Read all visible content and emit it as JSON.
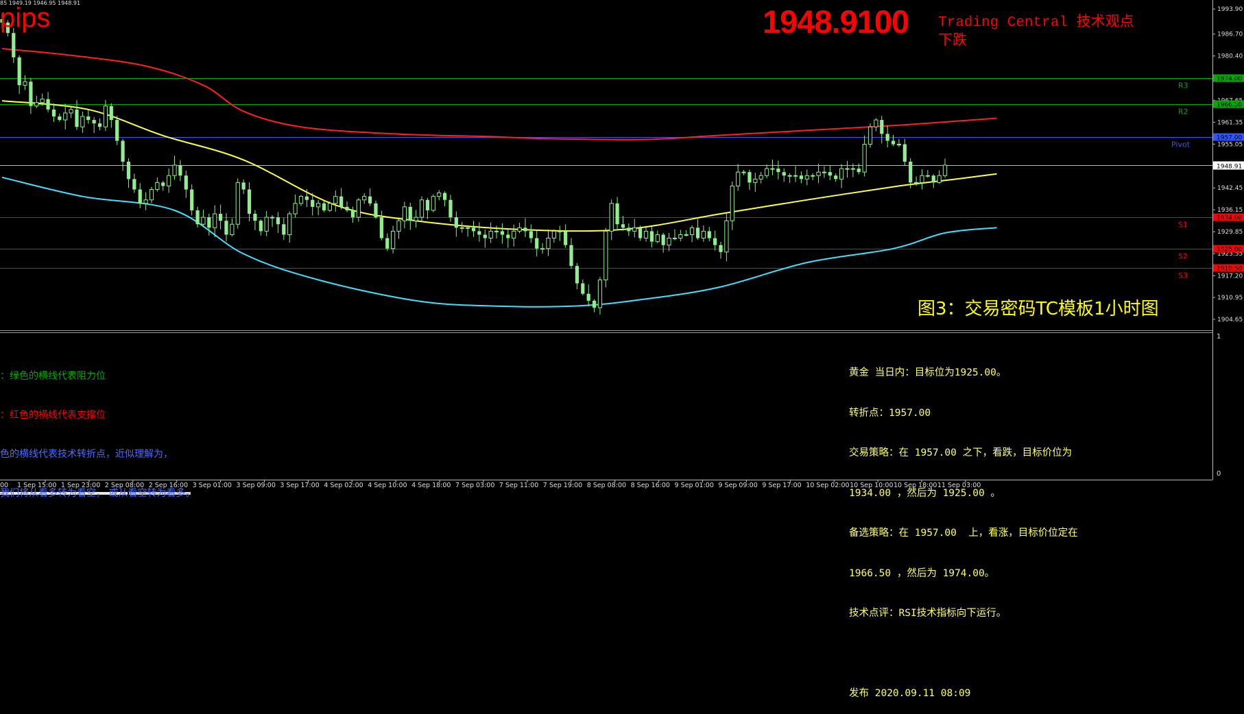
{
  "header": {
    "ohlc_text": "85 1949.19 1946.95 1948.91",
    "pips_label": "pips",
    "current_price": "1948.9100",
    "tc_title": "Trading Central 技术观点",
    "tc_view": "下跌"
  },
  "figure_label": "图3：交易密码TC模板1小时图",
  "legend": [
    {
      "text": "：绿色的横线代表阻力位",
      "color": "#00aa00"
    },
    {
      "text": "：红色的横线代表支撑位",
      "color": "#ff0000"
    },
    {
      "text": "色的横线代表技术转折点，近似理解为，",
      "color": "#4d6bff"
    },
    {
      "text": "我们将从看多转为看空， 或从看空转为看多。",
      "color": "#4d6bff"
    }
  ],
  "analysis": [
    "黄金 当日内：目标位为1925.00。",
    "转折点：1957.00",
    "交易策略：在 1957.00 之下，看跌，目标价位为",
    "1934.00 ，然后为 1925.00 。",
    "备选策略：在 1957.00  上，看涨，目标价位定在",
    "1966.50 ，然后为 1974.00。",
    "技术点评：RSI技术指标向下运行。",
    "",
    "发布 2020.09.11 08:09"
  ],
  "colors": {
    "background": "#000000",
    "resistance": "#00aa00",
    "support": "#ff0000",
    "pivot": "#3355ff",
    "upper_band": "#ff2020",
    "middle_ma": "#ffff40",
    "lower_band": "#40e0ff",
    "candle": "#90ee90",
    "price_line": "#bbbbbb"
  },
  "chart_data": {
    "type": "candlestick",
    "title": "",
    "symbol_timeframe": "1 hour",
    "ylim": [
      1901.5,
      1996.5
    ],
    "y_ticks": [
      "1993.90",
      "1986.70",
      "1980.40",
      "1974.00",
      "1967.65",
      "1966.50",
      "1961.35",
      "1957.00",
      "1955.05",
      "1948.91",
      "1942.45",
      "1936.15",
      "1934.00",
      "1929.85",
      "1925.00",
      "1923.55",
      "1919.50",
      "1917.20",
      "1910.95",
      "1904.65"
    ],
    "x_ticks": [
      "1 Sep 15:00",
      "1 Sep 23:00",
      "2 Sep 08:00",
      "2 Sep 16:00",
      "3 Sep 01:00",
      "3 Sep 09:00",
      "3 Sep 17:00",
      "4 Sep 02:00",
      "4 Sep 10:00",
      "4 Sep 18:00",
      "7 Sep 03:00",
      "7 Sep 11:00",
      "7 Sep 19:00",
      "8 Sep 08:00",
      "8 Sep 16:00",
      "9 Sep 01:00",
      "9 Sep 09:00",
      "9 Sep 17:00",
      "10 Sep 02:00",
      "10 Sep 10:00",
      "10 Sep 18:00",
      "11 Sep 03:00"
    ],
    "x_first_tick_fragment": "00",
    "levels": [
      {
        "name": "R3",
        "value": 1974.0,
        "label": "1974.00",
        "type": "resistance"
      },
      {
        "name": "R2",
        "value": 1966.5,
        "label": "1966.50",
        "type": "resistance"
      },
      {
        "name": "Pivot",
        "value": 1957.0,
        "label": "1957.00",
        "type": "pivot"
      },
      {
        "name": "S1",
        "value": 1934.0,
        "label": "1934.00",
        "type": "support"
      },
      {
        "name": "S2",
        "value": 1925.0,
        "label": "1925.00",
        "type": "support"
      },
      {
        "name": "S3",
        "value": 1919.5,
        "label": "1919.50",
        "type": "support"
      }
    ],
    "current_price": 1948.91,
    "closes": [
      1990,
      1987,
      1980,
      1972,
      1973,
      1966,
      1967,
      1968,
      1965,
      1963,
      1962,
      1964,
      1965,
      1960,
      1963,
      1962,
      1961,
      1960,
      1966,
      1962,
      1956,
      1950,
      1945,
      1942,
      1938,
      1939,
      1942,
      1944,
      1943,
      1946,
      1949,
      1946,
      1942,
      1936,
      1932,
      1934,
      1931,
      1935,
      1933,
      1929,
      1932,
      1944,
      1942,
      1935,
      1933,
      1930,
      1934,
      1934,
      1932,
      1929,
      1935,
      1938,
      1940,
      1939,
      1937,
      1938,
      1936,
      1938,
      1940,
      1937,
      1936,
      1934,
      1939,
      1940,
      1938,
      1934,
      1928,
      1925,
      1930,
      1933,
      1937,
      1933,
      1934,
      1939,
      1936,
      1940,
      1941,
      1939,
      1934,
      1931,
      1931,
      1931,
      1930,
      1929,
      1928,
      1930,
      1930,
      1929,
      1928,
      1930,
      1931,
      1930,
      1928,
      1925,
      1925,
      1928,
      1930,
      1930,
      1926,
      1920,
      1915,
      1912,
      1910,
      1908,
      1916,
      1930,
      1938,
      1932,
      1931,
      1930,
      1931,
      1928,
      1930,
      1927,
      1929,
      1926,
      1928,
      1928,
      1929,
      1929,
      1931,
      1928,
      1930,
      1928,
      1926,
      1924,
      1933,
      1943,
      1947,
      1947,
      1944,
      1945,
      1946,
      1948,
      1948,
      1947,
      1946,
      1946,
      1946,
      1945,
      1946,
      1946,
      1947,
      1947,
      1946,
      1945,
      1948,
      1948,
      1948,
      1947,
      1955,
      1960,
      1962,
      1958,
      1956,
      1955,
      1955,
      1950,
      1944,
      1944,
      1946,
      1946,
      1944,
      1946,
      1949
    ],
    "series": [
      {
        "name": "upper band",
        "points": [
          [
            0,
            1982.5
          ],
          [
            12,
            1980.6
          ],
          [
            25,
            1977.5
          ],
          [
            35,
            1972.0
          ],
          [
            42,
            1964.5
          ],
          [
            52,
            1960.0
          ],
          [
            68,
            1958.0
          ],
          [
            85,
            1957.2
          ],
          [
            95,
            1956.6
          ],
          [
            112,
            1956.4
          ],
          [
            124,
            1957.5
          ],
          [
            140,
            1959.0
          ],
          [
            156,
            1960.5
          ],
          [
            173,
            1962.5
          ]
        ]
      },
      {
        "name": "middle MA",
        "points": [
          [
            0,
            1967.5
          ],
          [
            15,
            1965.0
          ],
          [
            28,
            1957.5
          ],
          [
            42,
            1950.5
          ],
          [
            58,
            1937.5
          ],
          [
            72,
            1933.0
          ],
          [
            90,
            1930.5
          ],
          [
            108,
            1930.5
          ],
          [
            125,
            1935.0
          ],
          [
            140,
            1939.0
          ],
          [
            156,
            1943.0
          ],
          [
            166,
            1945.0
          ],
          [
            173,
            1946.5
          ]
        ]
      },
      {
        "name": "lower band",
        "points": [
          [
            0,
            1945.5
          ],
          [
            14,
            1940.0
          ],
          [
            30,
            1936.0
          ],
          [
            42,
            1923.5
          ],
          [
            55,
            1916.0
          ],
          [
            72,
            1910.0
          ],
          [
            85,
            1908.5
          ],
          [
            100,
            1908.5
          ],
          [
            112,
            1910.5
          ],
          [
            125,
            1914.0
          ],
          [
            140,
            1921.0
          ],
          [
            155,
            1925.0
          ],
          [
            164,
            1929.5
          ],
          [
            173,
            1931.0
          ]
        ]
      }
    ]
  }
}
